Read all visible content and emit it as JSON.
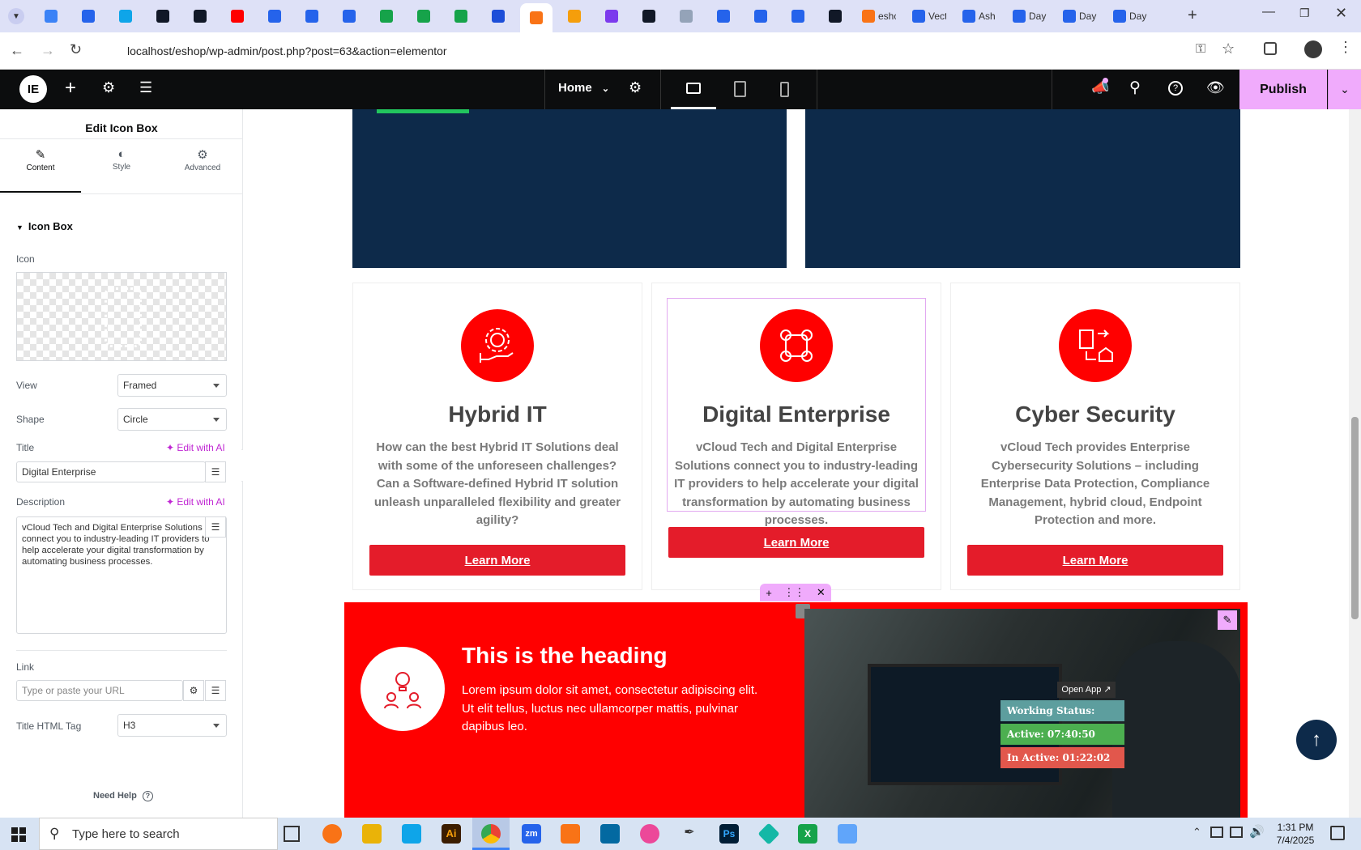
{
  "browser": {
    "tabs": [
      {
        "title": "",
        "color": "#3b82f6"
      },
      {
        "title": "",
        "color": "#2563eb"
      },
      {
        "title": "",
        "color": "#0ea5e9"
      },
      {
        "title": "",
        "color": "#111827"
      },
      {
        "title": "",
        "color": "#111827"
      },
      {
        "title": "",
        "color": "#ff0000"
      },
      {
        "title": "",
        "color": "#2563eb"
      },
      {
        "title": "",
        "color": "#2563eb"
      },
      {
        "title": "",
        "color": "#2563eb"
      },
      {
        "title": "",
        "color": "#16a34a"
      },
      {
        "title": "",
        "color": "#16a34a"
      },
      {
        "title": "",
        "color": "#16a34a"
      },
      {
        "title": "",
        "color": "#1d4ed8"
      },
      {
        "title": "",
        "color": "#f97316",
        "active": true
      },
      {
        "title": "",
        "color": "#f59e0b"
      },
      {
        "title": "",
        "color": "#7c3aed"
      },
      {
        "title": "",
        "color": "#111827"
      },
      {
        "title": "",
        "color": "#94a3b8"
      },
      {
        "title": "",
        "color": "#2563eb"
      },
      {
        "title": "",
        "color": "#2563eb"
      },
      {
        "title": "",
        "color": "#2563eb"
      },
      {
        "title": "",
        "color": "#111827"
      },
      {
        "title": "eshc",
        "color": "#f97316"
      },
      {
        "title": "Vect",
        "color": "#2563eb"
      },
      {
        "title": "Ash",
        "color": "#2563eb"
      },
      {
        "title": "Day",
        "color": "#2563eb"
      },
      {
        "title": "Day",
        "color": "#2563eb"
      },
      {
        "title": "Day",
        "color": "#2563eb"
      }
    ],
    "url": "localhost/eshop/wp-admin/post.php?post=63&action=elementor"
  },
  "editor_top": {
    "page_label": "Home",
    "publish_label": "Publish"
  },
  "panel": {
    "title": "Edit Icon Box",
    "tabs": [
      "Content",
      "Style",
      "Advanced"
    ],
    "section_title": "Icon Box",
    "icon_label": "Icon",
    "view_label": "View",
    "view_value": "Framed",
    "shape_label": "Shape",
    "shape_value": "Circle",
    "title_label": "Title",
    "edit_ai": "Edit with AI",
    "title_value": "Digital Enterprise",
    "description_label": "Description",
    "description_value": "vCloud Tech and Digital Enterprise Solutions connect you to industry-leading IT providers to help accelerate your digital transformation by automating business processes.",
    "link_label": "Link",
    "link_placeholder": "Type or paste your URL",
    "html_tag_label": "Title HTML Tag",
    "html_tag_value": "H3",
    "help_label": "Need Help"
  },
  "cards": [
    {
      "title": "Hybrid IT",
      "description": "How can the best Hybrid IT Solutions deal with some of the unforeseen challenges? Can a Software-defined Hybrid IT solution unleash unparalleled flexibility and greater agility?",
      "button": "Learn More"
    },
    {
      "title": "Digital Enterprise",
      "description": "vCloud Tech and Digital Enterprise Solutions connect you to industry-leading IT providers to help accelerate your digital transformation by automating business processes.",
      "button": "Learn More"
    },
    {
      "title": "Cyber Security",
      "description": "vCloud Tech provides Enterprise Cybersecurity Solutions – including Enterprise Data Protection, Compliance Management, hybrid cloud, Endpoint Protection and more.",
      "button": "Learn More"
    }
  ],
  "red_section": {
    "heading": "This is the heading",
    "body": "Lorem ipsum dolor sit amet, consectetur adipiscing elit. Ut elit tellus, luctus nec ullamcorper mattis, pulvinar dapibus leo."
  },
  "overlay_widget": {
    "open_app": "Open App ↗",
    "status": "Working Status: Active",
    "active": "Active: 07:40:50",
    "inactive": "In Active: 01:22:02"
  },
  "taskbar": {
    "search_placeholder": "Type here to search",
    "time": "1:31 PM",
    "date": "7/4/2025"
  }
}
